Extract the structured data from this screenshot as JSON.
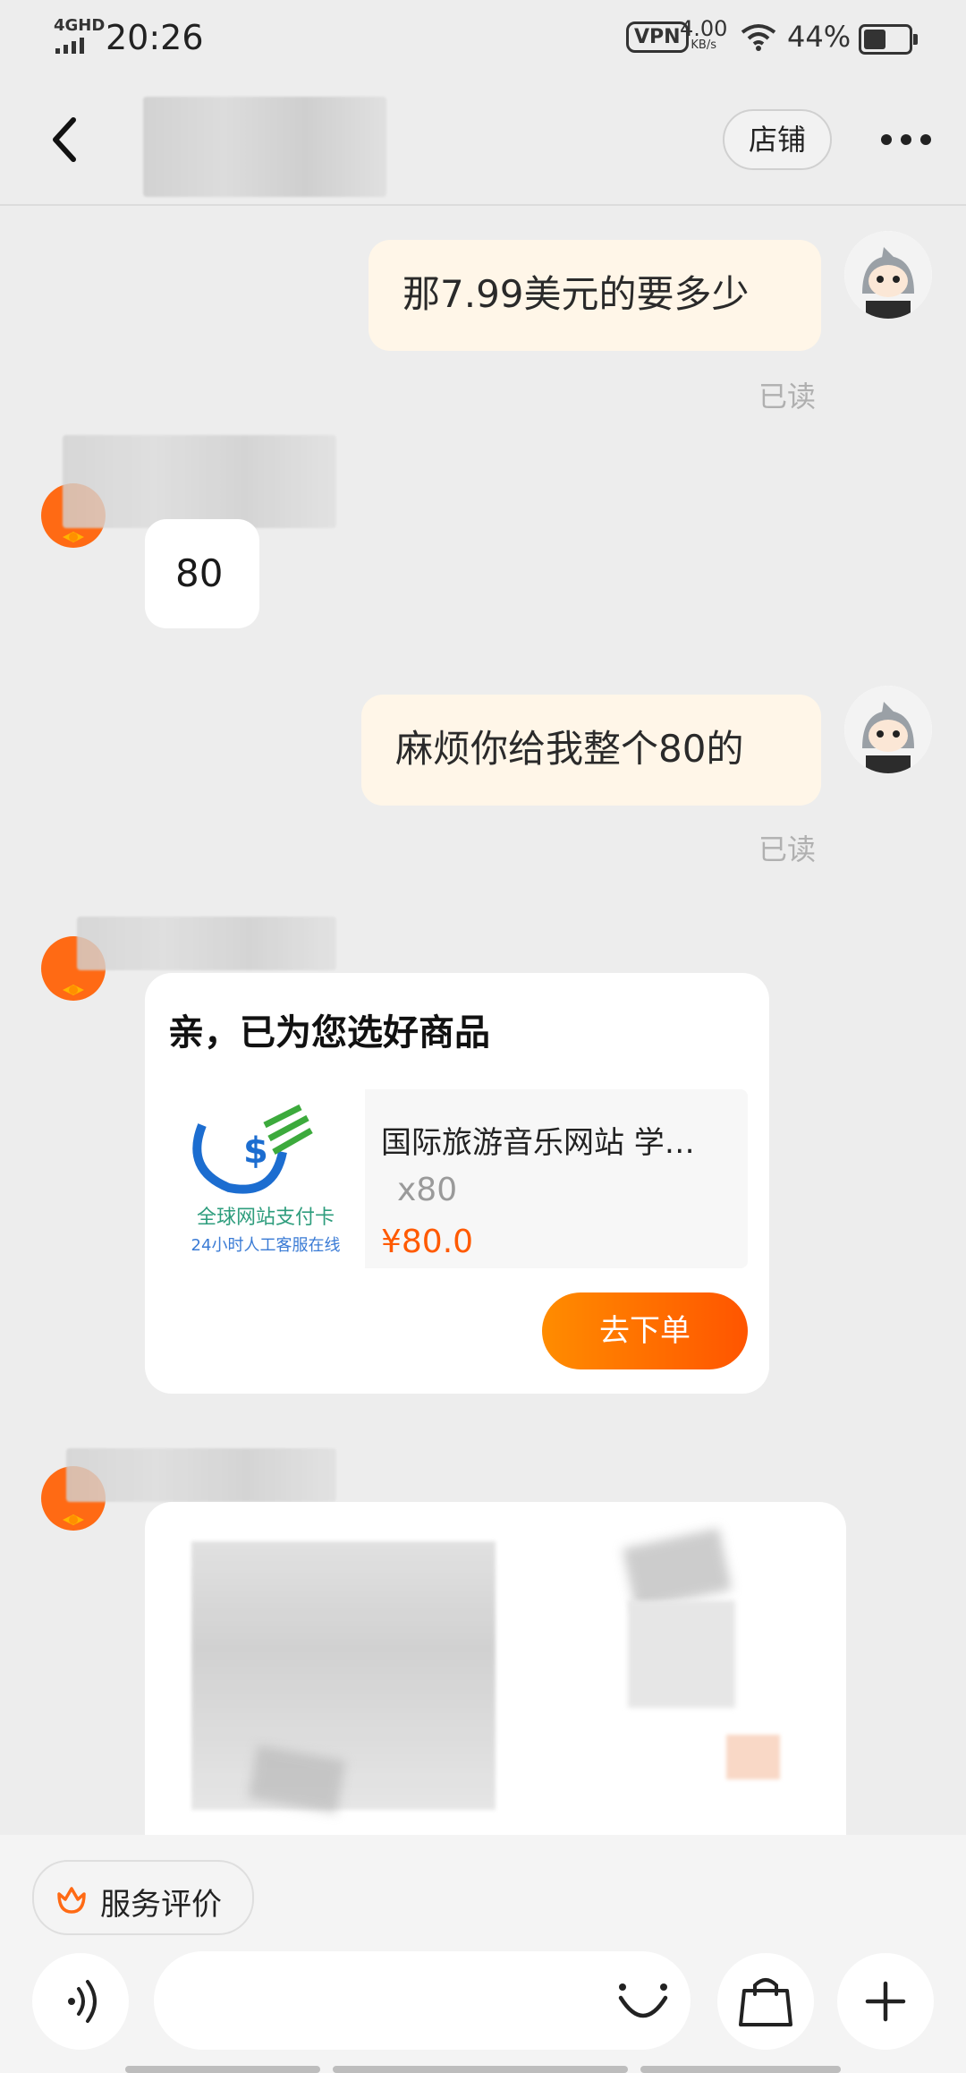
{
  "status_bar": {
    "network": "4GHD",
    "time": "20:26",
    "vpn": "VPN",
    "speed_value": "4.00",
    "speed_unit": "KB/s",
    "battery": "44%",
    "battery_level": 0.44
  },
  "header": {
    "shop_label": "店铺"
  },
  "messages": [
    {
      "side": "me",
      "text": "那7.99美元的要多少",
      "status": "已读"
    },
    {
      "side": "other",
      "text": "80"
    },
    {
      "side": "me",
      "text": "麻烦你给我整个80的",
      "status": "已读"
    }
  ],
  "product_card": {
    "title": "亲，已为您选好商品",
    "product_name": "国际旅游音乐网站 学…",
    "quantity": "x80",
    "price": "¥80.0",
    "image_line1": "全球网站支付卡",
    "image_line2": "24小时人工客服在线",
    "order_button": "去下单"
  },
  "bottom": {
    "eval_label": "服务评价"
  },
  "colors": {
    "accent": "#ff5a00",
    "my_bubble": "#fff6e8",
    "background": "#ededed"
  }
}
